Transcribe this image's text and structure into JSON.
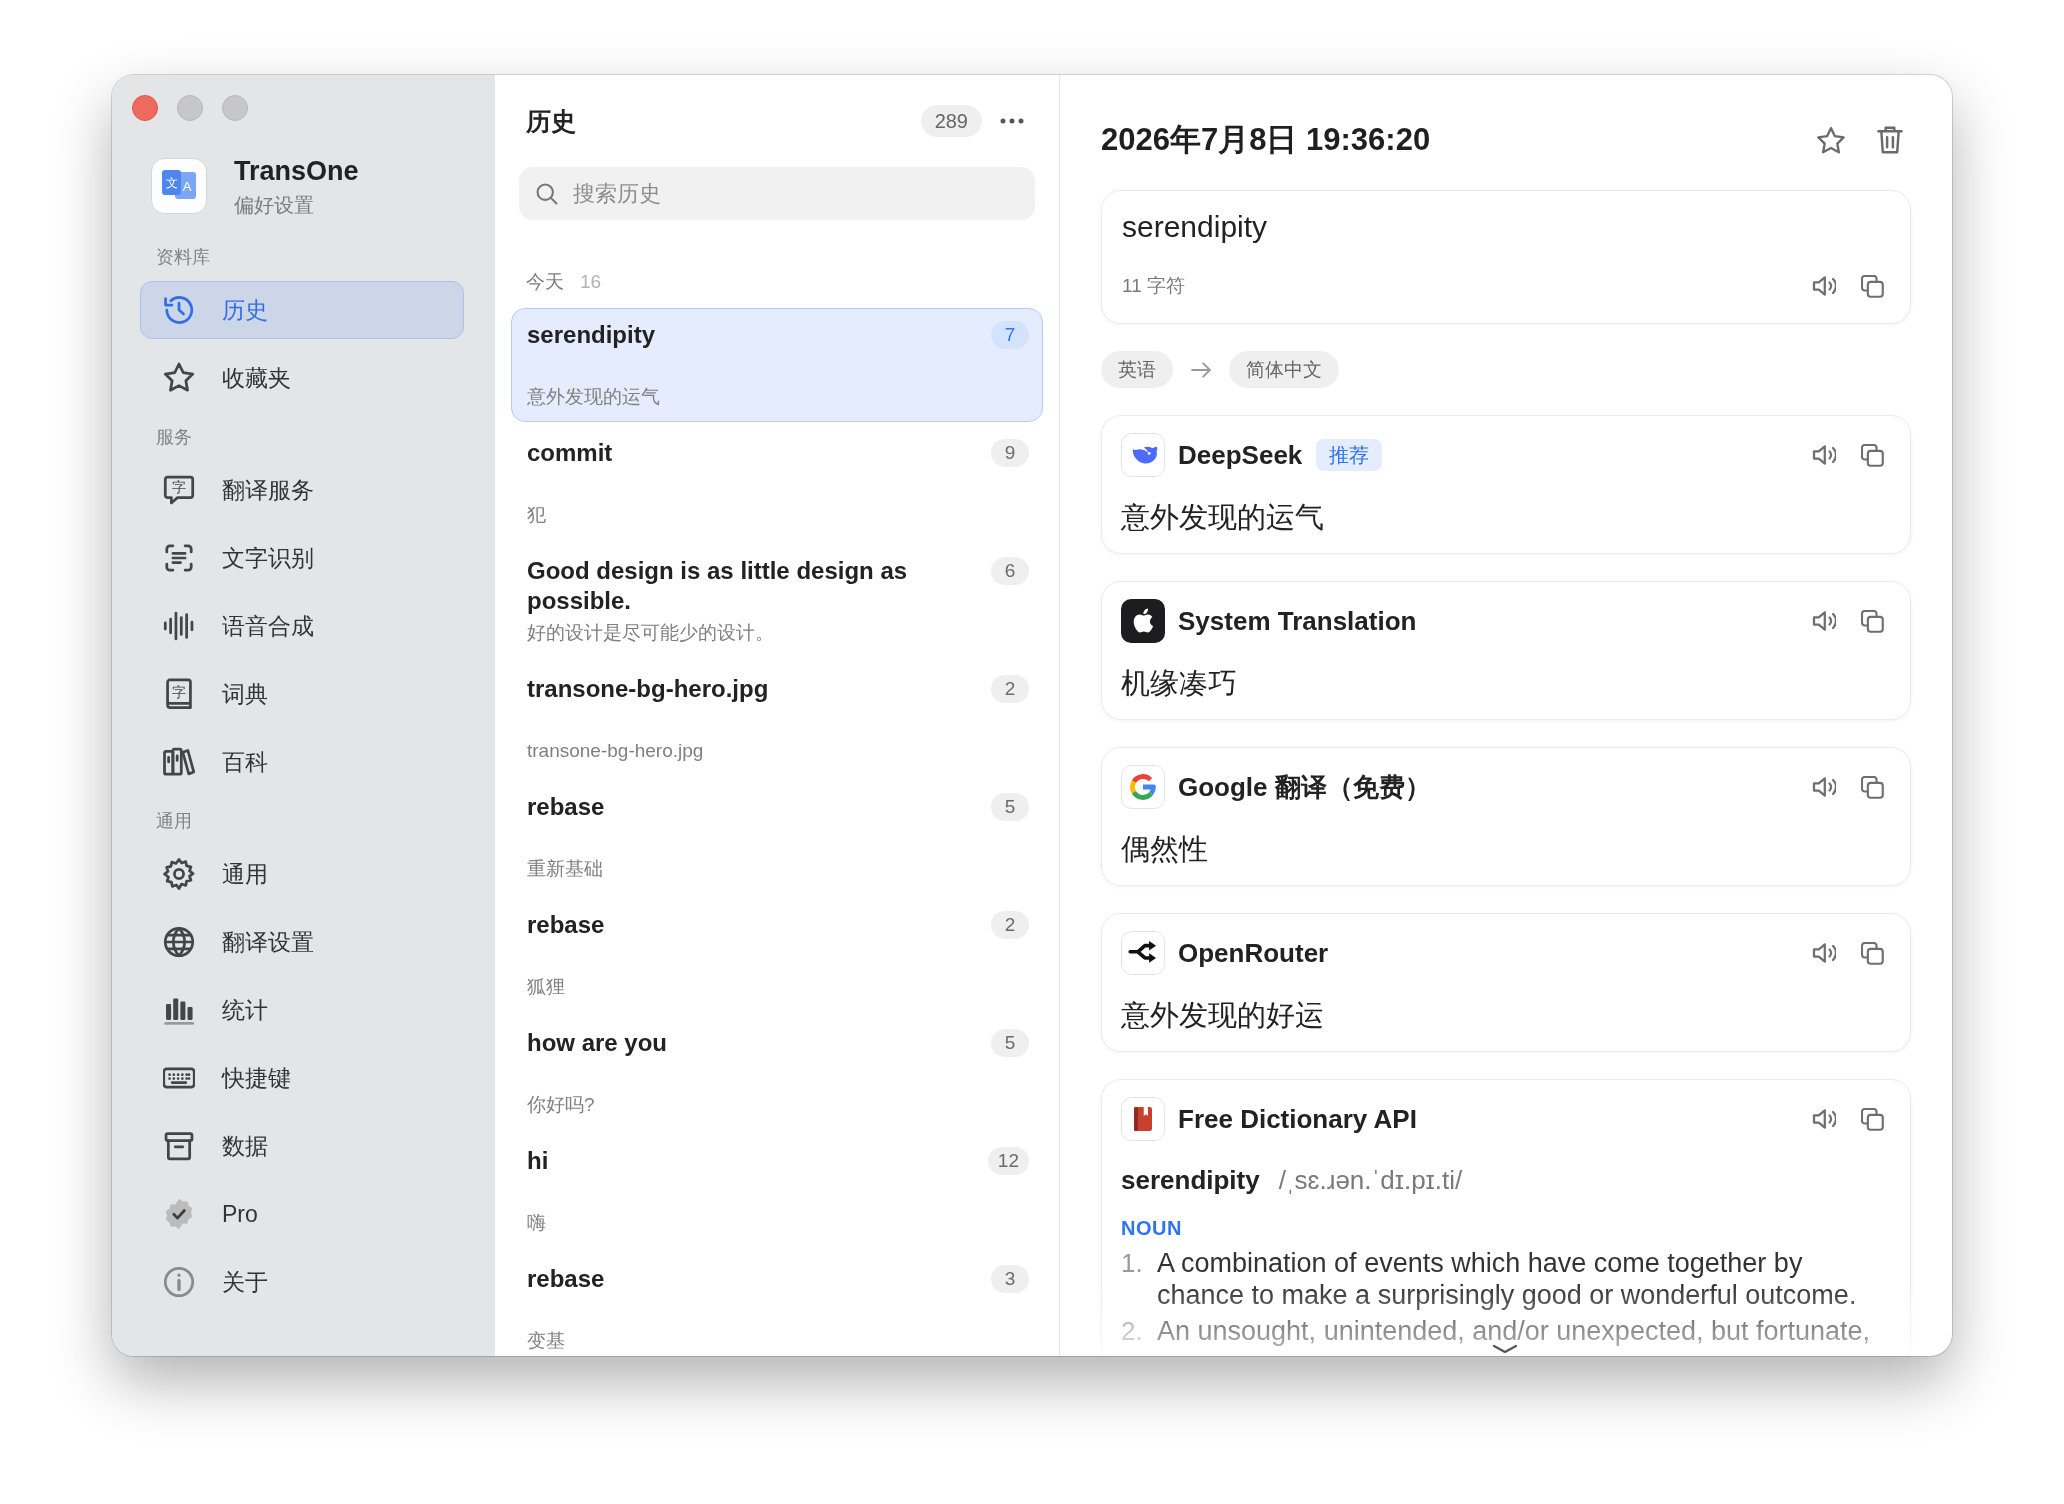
{
  "sidebar": {
    "app": {
      "name": "TransOne",
      "subtitle": "偏好设置",
      "icon_glyphs": [
        "文",
        "A"
      ]
    },
    "sections": [
      {
        "label": "资料库",
        "items": [
          {
            "label": "历史",
            "selected": true
          },
          {
            "label": "收藏夹",
            "selected": false
          }
        ]
      },
      {
        "label": "服务",
        "items": [
          {
            "label": "翻译服务",
            "selected": false,
            "icon_glyph": "字"
          },
          {
            "label": "文字识别",
            "selected": false
          },
          {
            "label": "语音合成",
            "selected": false
          },
          {
            "label": "词典",
            "selected": false,
            "icon_glyph": "字"
          },
          {
            "label": "百科",
            "selected": false
          }
        ]
      },
      {
        "label": "通用",
        "items": [
          {
            "label": "通用",
            "selected": false
          },
          {
            "label": "翻译设置",
            "selected": false
          },
          {
            "label": "统计",
            "selected": false
          },
          {
            "label": "快捷键",
            "selected": false
          },
          {
            "label": "数据",
            "selected": false
          },
          {
            "label": "Pro",
            "selected": false
          },
          {
            "label": "关于",
            "selected": false
          }
        ]
      }
    ]
  },
  "history": {
    "title": "历史",
    "count": "289",
    "search": {
      "placeholder": "搜索历史"
    },
    "groups": [
      {
        "label": "今天",
        "count": "16",
        "entries": [
          {
            "text": "serendipity",
            "translation": "意外发现的运气",
            "count": "7",
            "selected": true
          },
          {
            "text": "commit",
            "translation": "犯",
            "count": "9",
            "selected": false
          },
          {
            "text": "Good design is as little design as possible.",
            "translation": "好的设计是尽可能少的设计。",
            "count": "6",
            "selected": false
          },
          {
            "text": "transone-bg-hero.jpg",
            "translation": "transone-bg-hero.jpg",
            "count": "2",
            "selected": false
          },
          {
            "text": "rebase",
            "translation": "重新基础",
            "count": "5",
            "selected": false
          },
          {
            "text": "rebase",
            "translation": "狐狸",
            "count": "2",
            "selected": false
          },
          {
            "text": "how are you",
            "translation": "你好吗?",
            "count": "5",
            "selected": false
          },
          {
            "text": "hi",
            "translation": "嗨",
            "count": "12",
            "selected": false
          },
          {
            "text": "rebase",
            "translation": "变基",
            "count": "3",
            "selected": false
          }
        ]
      }
    ]
  },
  "detail": {
    "timestamp": "2026年7月8日 19:36:20",
    "source": {
      "text": "serendipity",
      "char_count": "11 字符"
    },
    "languages": {
      "from": "英语",
      "to": "简体中文"
    },
    "results": [
      {
        "kind": "translation",
        "service": "DeepSeek",
        "badge": "推荐",
        "text": "意外发现的运气"
      },
      {
        "kind": "translation",
        "service": "System Translation",
        "text": "机缘凑巧"
      },
      {
        "kind": "translation",
        "service": "Google 翻译（免费）",
        "text": "偶然性"
      },
      {
        "kind": "translation",
        "service": "OpenRouter",
        "text": "意外发现的好运"
      },
      {
        "kind": "dictionary",
        "service": "Free Dictionary API",
        "headword": "serendipity",
        "phonetic": "/ˌsɛ.ɹən.ˈdɪ.pɪ.ti/",
        "part_of_speech": "NOUN",
        "definitions": [
          {
            "number": "1.",
            "text": "A combination of events which have come together by chance to make a surprisingly good or wonderful outcome."
          },
          {
            "number": "2.",
            "text": "An unsought, unintended, and/or unexpected, but fortunate,"
          }
        ]
      }
    ]
  }
}
